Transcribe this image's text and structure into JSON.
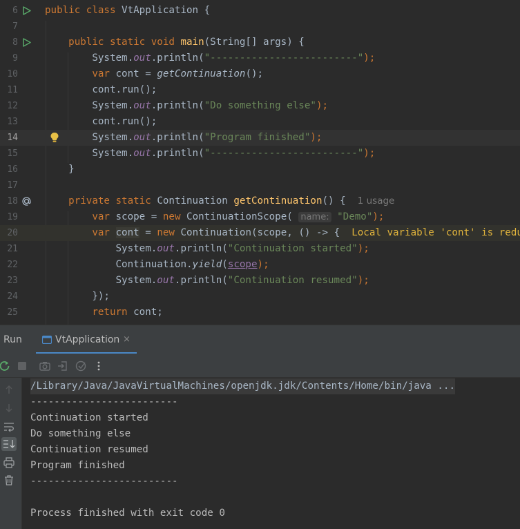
{
  "editor": {
    "lines": [
      {
        "n": "6"
      },
      {
        "n": "7"
      },
      {
        "n": "8"
      },
      {
        "n": "9"
      },
      {
        "n": "10"
      },
      {
        "n": "11"
      },
      {
        "n": "12"
      },
      {
        "n": "13"
      },
      {
        "n": "14"
      },
      {
        "n": "15"
      },
      {
        "n": "16"
      },
      {
        "n": "17"
      },
      {
        "n": "18"
      },
      {
        "n": "19"
      },
      {
        "n": "20"
      },
      {
        "n": "21"
      },
      {
        "n": "22"
      },
      {
        "n": "23"
      },
      {
        "n": "24"
      },
      {
        "n": "25"
      }
    ],
    "t": {
      "public_class": "public class",
      "class_name": "VtApplication",
      "brace_open": "{",
      "public_static_void": "public static void",
      "main": "main",
      "main_params": "(String[] args) {",
      "system": "System.",
      "out": "out",
      "println_open": ".println(",
      "dashes_str": "\"-------------------------\"",
      "close_semi": ");",
      "var": "var",
      "cont_assign": "cont =",
      "get_continuation_call": "getContinuation",
      "call_end": "();",
      "cont_run": "cont.run();",
      "do_something_str": "\"Do something else\"",
      "program_finished_str": "\"Program finished\"",
      "close_brace": "}",
      "private_static": "private static",
      "continuation_type": "Continuation",
      "get_continuation_decl": "getContinuation",
      "decl_end": "() {",
      "usage_hint": "1 usage",
      "scope_assign": "scope =",
      "new": "new",
      "continuation_scope_open": "ContinuationScope(",
      "param_hint": "name:",
      "demo_str": "\"Demo\"",
      "cont_var": "cont",
      "equals": "=",
      "continuation_ctor": "Continuation(scope, () -> {",
      "warning": "Local variable 'cont' is redundant.",
      "cont_started_str": "\"Continuation started\"",
      "continuation_dot": "Continuation.",
      "yield": "yield",
      "paren_open": "(",
      "scope": "scope",
      "cont_resumed_str": "\"Continuation resumed\"",
      "lambda_end": "});",
      "return_kw": "return",
      "return_val": "cont;"
    }
  },
  "run_panel": {
    "run_label": "Run",
    "tab_label": "VtApplication",
    "tab_close": "×",
    "console_lines": [
      "/Library/Java/JavaVirtualMachines/openjdk.jdk/Contents/Home/bin/java ...",
      "-------------------------",
      "Continuation started",
      "Do something else",
      "Continuation resumed",
      "Program finished",
      "-------------------------",
      "",
      "Process finished with exit code 0"
    ]
  },
  "icons": {
    "run_gutter": "run-icon",
    "override_gutter": "implementation-icon",
    "bulb": "lightbulb-icon",
    "rerun": "rerun-icon",
    "stop": "stop-icon",
    "camera": "screenshot-icon",
    "login": "attach-icon",
    "coverage": "coverage-icon",
    "more": "more-icon"
  },
  "colors": {
    "keyword": "#cc7832",
    "function": "#ffc66d",
    "string": "#6a8759",
    "field": "#9876aa",
    "warning": "#e0b33c",
    "tab_accent": "#4a88c7",
    "run_green": "#59a869"
  }
}
